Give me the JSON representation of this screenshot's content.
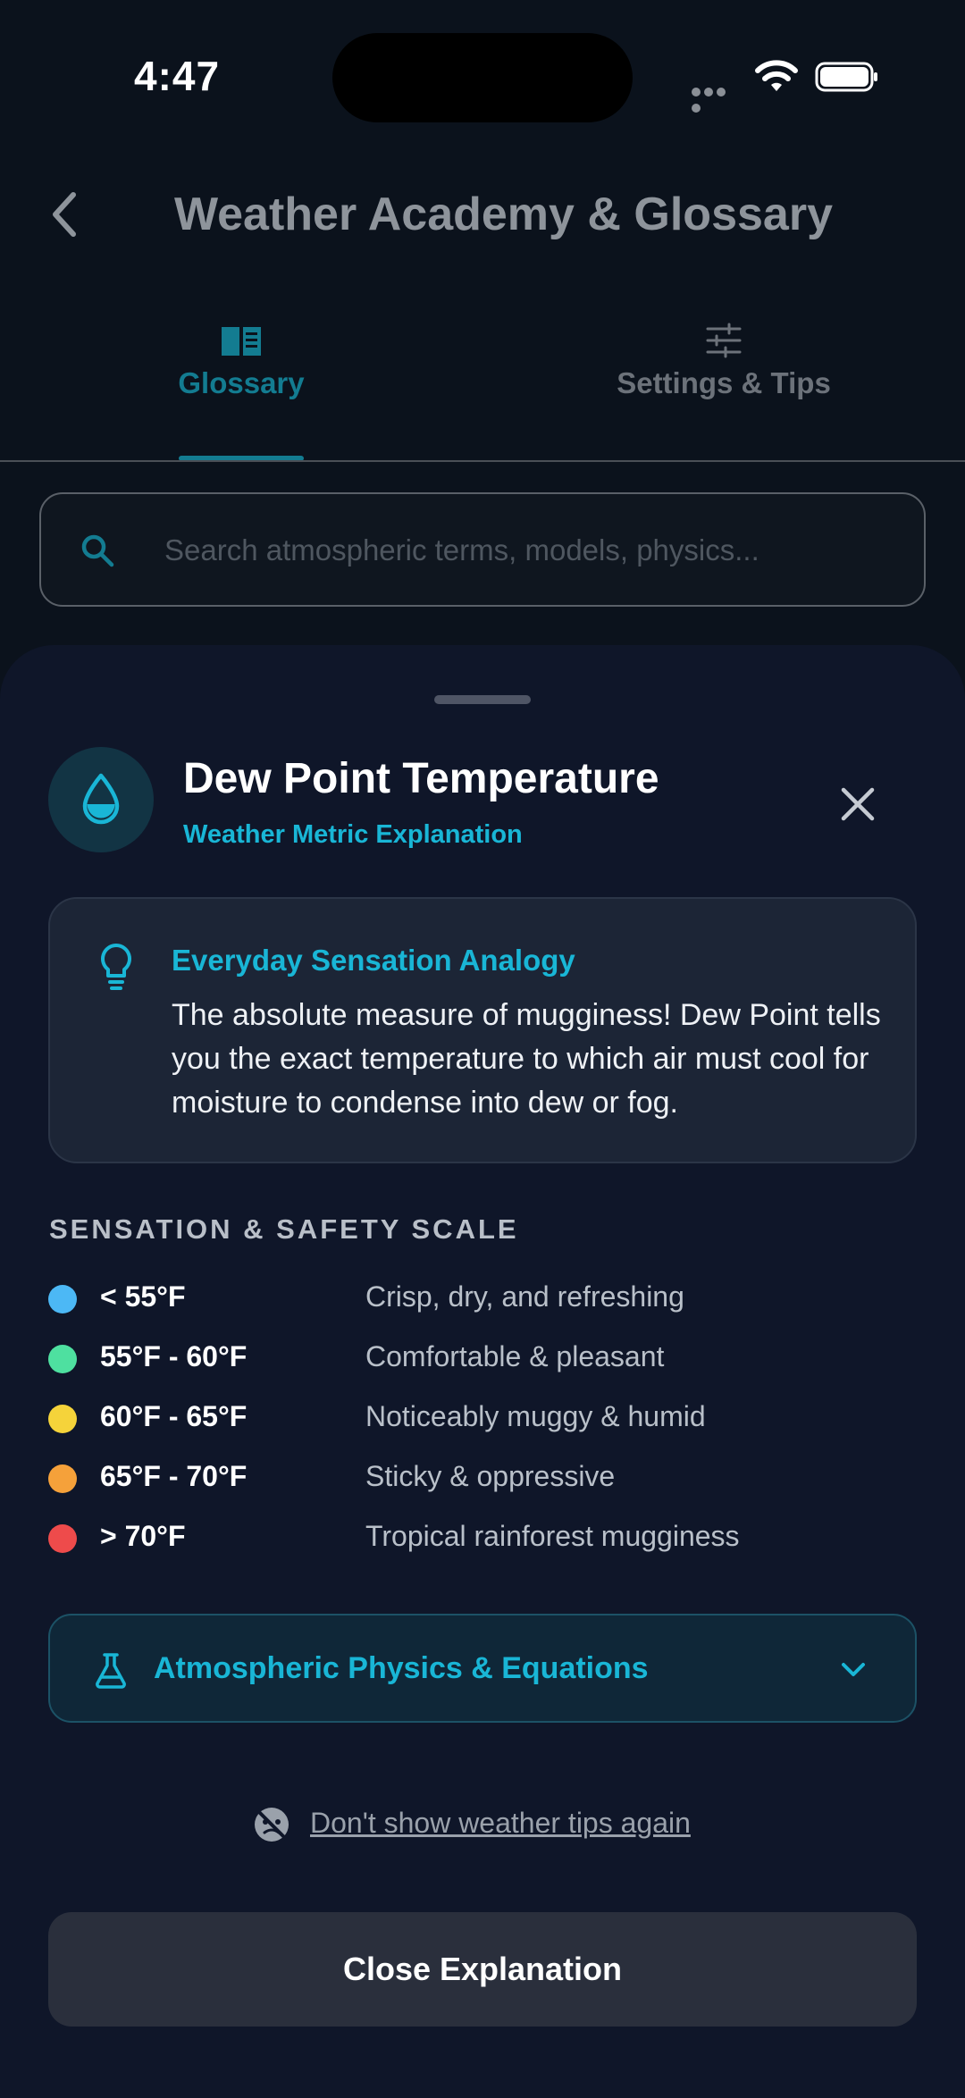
{
  "status_bar": {
    "time": "4:47"
  },
  "header": {
    "title": "Weather Academy & Glossary"
  },
  "tabs": [
    {
      "label": "Glossary",
      "icon": "book-icon",
      "active": true
    },
    {
      "label": "Settings & Tips",
      "icon": "sliders-icon",
      "active": false
    }
  ],
  "search": {
    "placeholder": "Search atmospheric terms, models, physics...",
    "value": ""
  },
  "sheet": {
    "title": "Dew Point Temperature",
    "subtitle": "Weather Metric Explanation",
    "icon": "water-drop-icon",
    "analogy": {
      "title": "Everyday Sensation Analogy",
      "body": "The absolute measure of mugginess! Dew Point tells you the exact temperature to which air must cool for moisture to condense into dew or fog."
    },
    "scale": {
      "heading": "SENSATION & SAFETY SCALE",
      "rows": [
        {
          "range": "< 55°F",
          "desc": "Crisp, dry, and refreshing",
          "color": "#4cb8f5"
        },
        {
          "range": "55°F - 60°F",
          "desc": "Comfortable & pleasant",
          "color": "#4ee0a0"
        },
        {
          "range": "60°F - 65°F",
          "desc": "Noticeably muggy & humid",
          "color": "#f5d33a"
        },
        {
          "range": "65°F - 70°F",
          "desc": "Sticky & oppressive",
          "color": "#f5a13a"
        },
        {
          "range": "> 70°F",
          "desc": "Tropical rainforest mugginess",
          "color": "#ee4b4b"
        }
      ]
    },
    "physics_label": "Atmospheric Physics & Equations",
    "tips_link": "Don't show weather tips again",
    "close_button": "Close Explanation"
  },
  "colors": {
    "accent": "#19b6d6",
    "sheet_bg": "#0f1629",
    "page_bg": "#0b121c"
  }
}
